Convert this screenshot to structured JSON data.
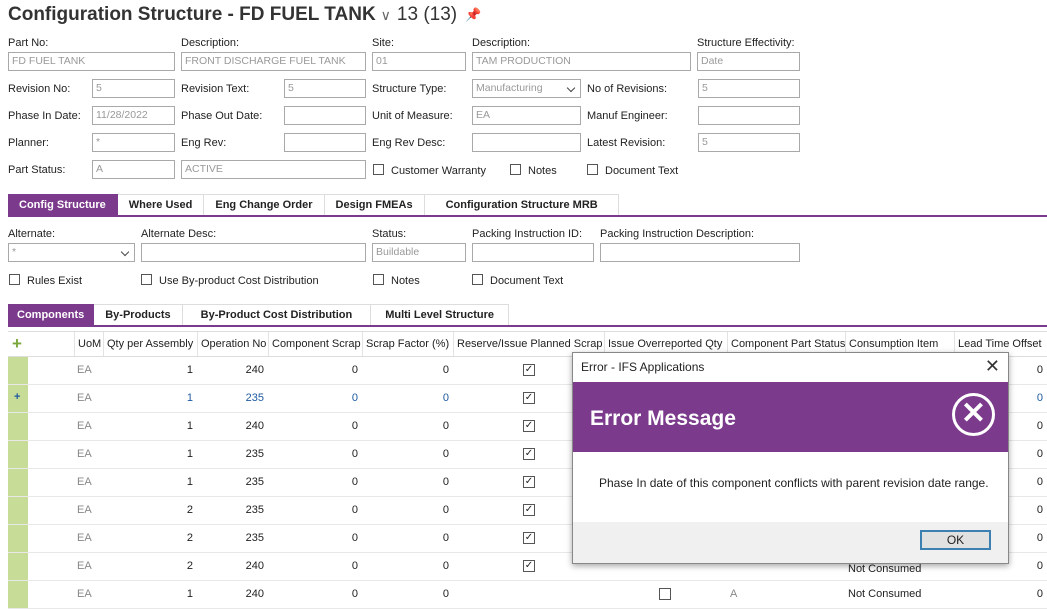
{
  "header": {
    "title": "Configuration Structure - FD FUEL TANK",
    "count": "13 (13)"
  },
  "form": {
    "part_no": {
      "label": "Part No:",
      "value": "FD FUEL TANK"
    },
    "description": {
      "label": "Description:",
      "value": "FRONT DISCHARGE FUEL TANK"
    },
    "site": {
      "label": "Site:",
      "value": "01"
    },
    "site_description": {
      "label": "Description:",
      "value": "TAM PRODUCTION"
    },
    "structure_effectivity": {
      "label": "Structure Effectivity:",
      "value": "Date"
    },
    "revision_no": {
      "label": "Revision No:",
      "value": "5"
    },
    "revision_text": {
      "label": "Revision Text:",
      "value": "5"
    },
    "structure_type": {
      "label": "Structure Type:",
      "value": "Manufacturing"
    },
    "no_of_revisions": {
      "label": "No of Revisions:",
      "value": "5"
    },
    "phase_in_date": {
      "label": "Phase In Date:",
      "value": "11/28/2022"
    },
    "phase_out_date": {
      "label": "Phase Out Date:",
      "value": ""
    },
    "unit_of_measure": {
      "label": "Unit of Measure:",
      "value": "EA"
    },
    "manuf_engineer": {
      "label": "Manuf Engineer:",
      "value": ""
    },
    "planner": {
      "label": "Planner:",
      "value": "*"
    },
    "eng_rev": {
      "label": "Eng Rev:",
      "value": ""
    },
    "eng_rev_desc": {
      "label": "Eng Rev Desc:",
      "value": ""
    },
    "latest_revision": {
      "label": "Latest Revision:",
      "value": "5"
    },
    "part_status": {
      "label": "Part Status:",
      "value": "A"
    },
    "part_status_desc": {
      "value": "ACTIVE"
    },
    "customer_warranty": "Customer Warranty",
    "notes": "Notes",
    "document_text": "Document Text"
  },
  "main_tabs": [
    "Config Structure",
    "Where Used",
    "Eng Change Order",
    "Design FMEAs",
    "Configuration Structure MRB"
  ],
  "sub_form": {
    "alternate": {
      "label": "Alternate:",
      "value": "*"
    },
    "alternate_desc": {
      "label": "Alternate Desc:",
      "value": ""
    },
    "status": {
      "label": "Status:",
      "value": "Buildable"
    },
    "packing_instruction_id": {
      "label": "Packing Instruction ID:",
      "value": ""
    },
    "packing_instruction_desc": {
      "label": "Packing Instruction Description:",
      "value": ""
    },
    "rules_exist": "Rules Exist",
    "use_byproduct": "Use By-product Cost Distribution",
    "notes": "Notes",
    "document_text": "Document Text"
  },
  "sub_tabs": [
    "Components",
    "By-Products",
    "By-Product Cost Distribution",
    "Multi Level Structure"
  ],
  "grid": {
    "add_icon": "+",
    "columns": [
      "UoM",
      "Qty per Assembly",
      "Operation No",
      "Component Scrap",
      "Scrap Factor (%)",
      "Reserve/Issue Planned Scrap",
      "Issue Overreported Qty",
      "Component Part Status",
      "Consumption Item",
      "Lead Time Offset"
    ],
    "rows": [
      {
        "uom": "EA",
        "qty": "1",
        "op": "240",
        "scrap": "0",
        "factor": "0",
        "lead": "0"
      },
      {
        "uom": "EA",
        "qty": "1",
        "op": "235",
        "scrap": "0",
        "factor": "0",
        "lead": "0"
      },
      {
        "uom": "EA",
        "qty": "1",
        "op": "240",
        "scrap": "0",
        "factor": "0",
        "lead": "0"
      },
      {
        "uom": "EA",
        "qty": "1",
        "op": "235",
        "scrap": "0",
        "factor": "0",
        "lead": "0"
      },
      {
        "uom": "EA",
        "qty": "1",
        "op": "235",
        "scrap": "0",
        "factor": "0",
        "lead": "0"
      },
      {
        "uom": "EA",
        "qty": "2",
        "op": "235",
        "scrap": "0",
        "factor": "0",
        "lead": "0"
      },
      {
        "uom": "EA",
        "qty": "2",
        "op": "235",
        "scrap": "0",
        "factor": "0",
        "lead": "0"
      },
      {
        "uom": "EA",
        "qty": "2",
        "op": "240",
        "scrap": "0",
        "factor": "0",
        "lead": "0",
        "consumption": "Not Consumed"
      },
      {
        "uom": "EA",
        "qty": "1",
        "op": "240",
        "scrap": "0",
        "factor": "0",
        "lead": "0",
        "status": "A",
        "consumption": "Not Consumed"
      }
    ]
  },
  "dialog": {
    "title": "Error - IFS Applications",
    "close": "✕",
    "heading": "Error Message",
    "icon": "✕",
    "message": "Phase In date of this component conflicts with parent revision date range.",
    "ok": "OK"
  }
}
